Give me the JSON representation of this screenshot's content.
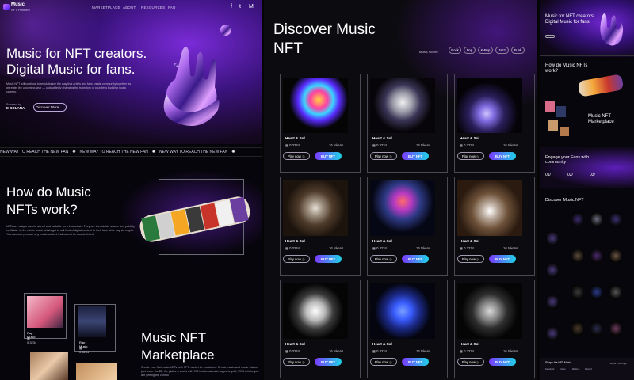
{
  "panel1": {
    "brand": {
      "name": "Music",
      "sub": "NFT Platform"
    },
    "nav": [
      "MARKETPLACE",
      "ABOUT",
      "RESOURCES",
      "FAQ"
    ],
    "social_icons": [
      "facebook-icon",
      "twitter-icon",
      "medium-icon"
    ],
    "social_glyphs": [
      "f",
      "t",
      "M"
    ],
    "hero": {
      "title": "Music for NFT creators. Digital Music for fans.",
      "desc": "Music NFT will continue to revolutionize the way that artists and fans create community together as we enter the upcoming year — undoubtedly changing the trajectory of countless budding music careers.",
      "powered_label": "Powered by",
      "powered_brand": "E SOLANA",
      "cta": "Discover More"
    },
    "ticker": "NEW WAY TO REACH THE NEW FAN",
    "how": {
      "title": "How do Music NFTs work?",
      "desc": "NFTs are unique assets stored and tradable on a blockchain. They are immutable, scarce and publicly verifiable. In the music world, artists get to sell limited digital content to their fans while pay via crypto. You can now produce any music content that cannot be counterfeited."
    },
    "tiles": [
      {
        "caption": "Rap Music",
        "price": "0.3234"
      },
      {
        "caption": "Rap Music",
        "price": "0.3234"
      }
    ],
    "marketplace": {
      "title": "Music NFT Marketplace",
      "desc": "Create your first music NFTs with NFT market for musicians. Create music and music videos just under the $1, the platform works with 990 blockchain and supports gold, 9999 artists, you are getting the control"
    }
  },
  "panel2": {
    "title": "Discover Music NFT",
    "genre_label": "Music Genre",
    "genres": [
      "Rock",
      "Pop",
      "K-Pop",
      "Jazz",
      "Funk"
    ],
    "cards": [
      {
        "name": "Heart & Sol",
        "price": "0.3234",
        "tokens": "16 tokens",
        "play": "Play now",
        "buy": "BUY NFT"
      },
      {
        "name": "Heart & Sol",
        "price": "0.3234",
        "tokens": "16 tokens",
        "play": "Play now",
        "buy": "BUY NFT"
      },
      {
        "name": "Heart & Sol",
        "price": "0.3234",
        "tokens": "16 tokens",
        "play": "Play now",
        "buy": "BUY NFT"
      },
      {
        "name": "Heart & Sol",
        "price": "0.3234",
        "tokens": "16 tokens",
        "play": "Play now",
        "buy": "BUY NFT"
      },
      {
        "name": "Heart & Sol",
        "price": "0.3234",
        "tokens": "16 tokens",
        "play": "Play now",
        "buy": "BUY NFT"
      },
      {
        "name": "Heart & Sol",
        "price": "0.3234",
        "tokens": "16 tokens",
        "play": "Play now",
        "buy": "BUY NFT"
      },
      {
        "name": "Heart & Sol",
        "price": "0.3234",
        "tokens": "16 tokens",
        "play": "Play now",
        "buy": "BUY NFT"
      },
      {
        "name": "Heart & Sol",
        "price": "0.3234",
        "tokens": "16 tokens",
        "play": "Play now",
        "buy": "BUY NFT"
      },
      {
        "name": "Heart & Sol",
        "price": "0.3234",
        "tokens": "16 tokens",
        "play": "Play now",
        "buy": "BUY NFT"
      }
    ]
  },
  "panel3": {
    "hero_title": "Music for NFT creators. Digital Music for fans.",
    "how_title": "How do Music NFTs work?",
    "marketplace_title": "Music NFT Marketplace",
    "engage_title": "Engage your Fans with community",
    "steps": [
      "01/",
      "02/",
      "03/"
    ],
    "discover_title": "Discover Music NFT",
    "shape_title": "Shape the NFT Music",
    "footer_links": [
      "Facebook",
      "Twitter",
      "Medium",
      "Discord"
    ],
    "footer_note": "♥ Home & the Page"
  },
  "colors": {
    "accent_purple": "#7b39ff",
    "accent_cyan": "#1fd2e8",
    "background": "#050505"
  }
}
